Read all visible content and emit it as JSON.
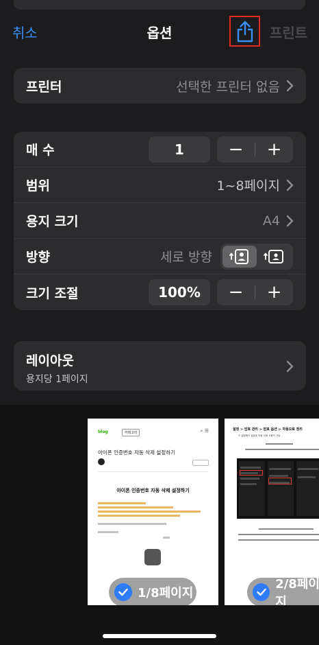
{
  "nav": {
    "cancel": "취소",
    "title": "옵션",
    "share_icon": "share-icon",
    "print": "프린트"
  },
  "printer": {
    "label": "프린터",
    "value": "선택한 프린터 없음"
  },
  "settings": {
    "copies_label": "매 수",
    "copies_value": "1",
    "minus": "−",
    "plus": "+",
    "range_label": "범위",
    "range_value": "1~8페이지",
    "paper_label": "용지 크기",
    "paper_value": "A4",
    "orientation_label": "방향",
    "orientation_value": "세로 방향",
    "scale_label": "크기 조절",
    "scale_value": "100%"
  },
  "layout": {
    "label": "레이아웃",
    "sub": "용지당 1페이지"
  },
  "preview": {
    "pages": [
      {
        "label": "1/8페이지",
        "selected": true
      },
      {
        "label": "2/8페이지",
        "selected": true
      }
    ],
    "page1": {
      "blog": "blog",
      "nav_tag": "카테고리",
      "title": "아이폰 인증번호 자동 삭제 설정하기",
      "heading": "아이폰 인증번호 자동 삭제 설정하기"
    },
    "page2": {
      "heading": "설정 > 암호 관리 > 암호 옵션 > 자동으로 정리",
      "sub": "이 설정에서 암호로 자동 삭제 사용이 가능"
    }
  },
  "colors": {
    "accent": "#3a8ef6",
    "background": "#1c1c1e",
    "group": "#2c2c2e",
    "highlight_box": "#e32b2b"
  }
}
